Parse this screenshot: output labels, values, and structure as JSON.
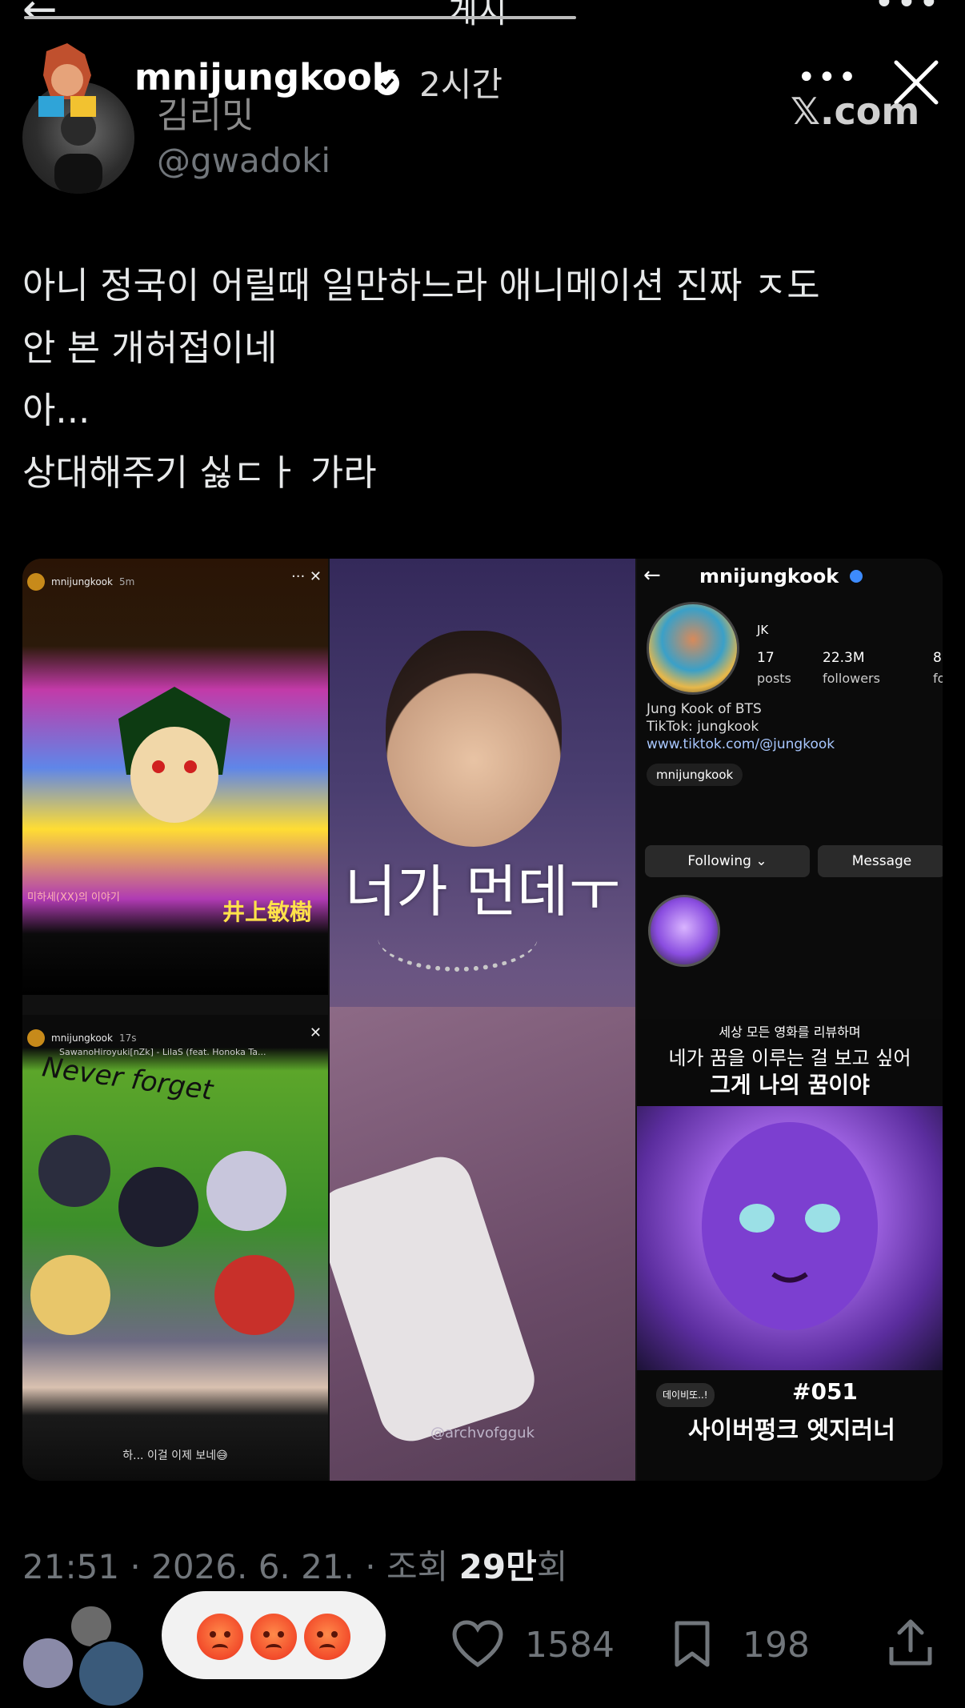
{
  "topbar": {
    "title": "게시"
  },
  "overlay": {
    "username": "mnijungkook",
    "time": "2시간",
    "site": "𝕏.com"
  },
  "author": {
    "name": "김리밋",
    "handle": "@gwadoki"
  },
  "tweet": {
    "lines": [
      "아니 정국이 어릴때 일만하느라 애니메이션 진짜 ㅈ도",
      "안 본 개허접이네",
      "아...",
      "상대해주기 싫ㄷㅏ 가라"
    ]
  },
  "media": {
    "left_top": {
      "username": "mnijungkook",
      "time": "5m",
      "caption": "미하세(XX)의 이야기",
      "kanji": "井上敏樹"
    },
    "left_bottom": {
      "username": "mnijungkook",
      "time": "17s",
      "music": "SawanoHiroyuki[nZk] - LilaS (feat. Honoka Ta...",
      "script": "Never forget",
      "caption": "하... 이걸 이제 보네😅"
    },
    "center": {
      "overlay_text": "너가 먼데ㅜ",
      "watermark": "@archvofgguk"
    },
    "right": {
      "username": "mnijungkook",
      "name": "JK",
      "stats": [
        {
          "num": "17",
          "label": "posts"
        },
        {
          "num": "22.3M",
          "label": "followers"
        },
        {
          "num": "8",
          "label": "fo"
        }
      ],
      "bio1": "Jung Kook of BTS",
      "bio2": "TikTok: jungkook",
      "link": "www.tiktok.com/@jungkook",
      "threads": "mnijungkook",
      "following": "Following ⌄",
      "message": "Message",
      "cap1": "세상 모든 영화를 리뷰하며",
      "cap2": "네가 꿈을 이루는 걸 보고 싶어",
      "cap3": "그게 나의 꿈이야",
      "tag": "데이비또..!",
      "num": "#051",
      "title": "사이버펑크 엣지러너"
    }
  },
  "meta": {
    "time": "21:51",
    "date": "2026. 6. 21.",
    "views_prefix": "조회",
    "views": "29만",
    "views_suffix": "회"
  },
  "actions": {
    "likes": "1584",
    "bookmarks": "198"
  },
  "icons": [
    "back-arrow-icon",
    "more-icon",
    "close-icon",
    "verified-icon",
    "heart-icon",
    "bookmark-icon",
    "share-icon",
    "angry-emoji-icon"
  ],
  "colors": {
    "background": "#000000",
    "text": "#e7e9ea",
    "muted": "#71767b",
    "verified": "#3d8bfd"
  }
}
